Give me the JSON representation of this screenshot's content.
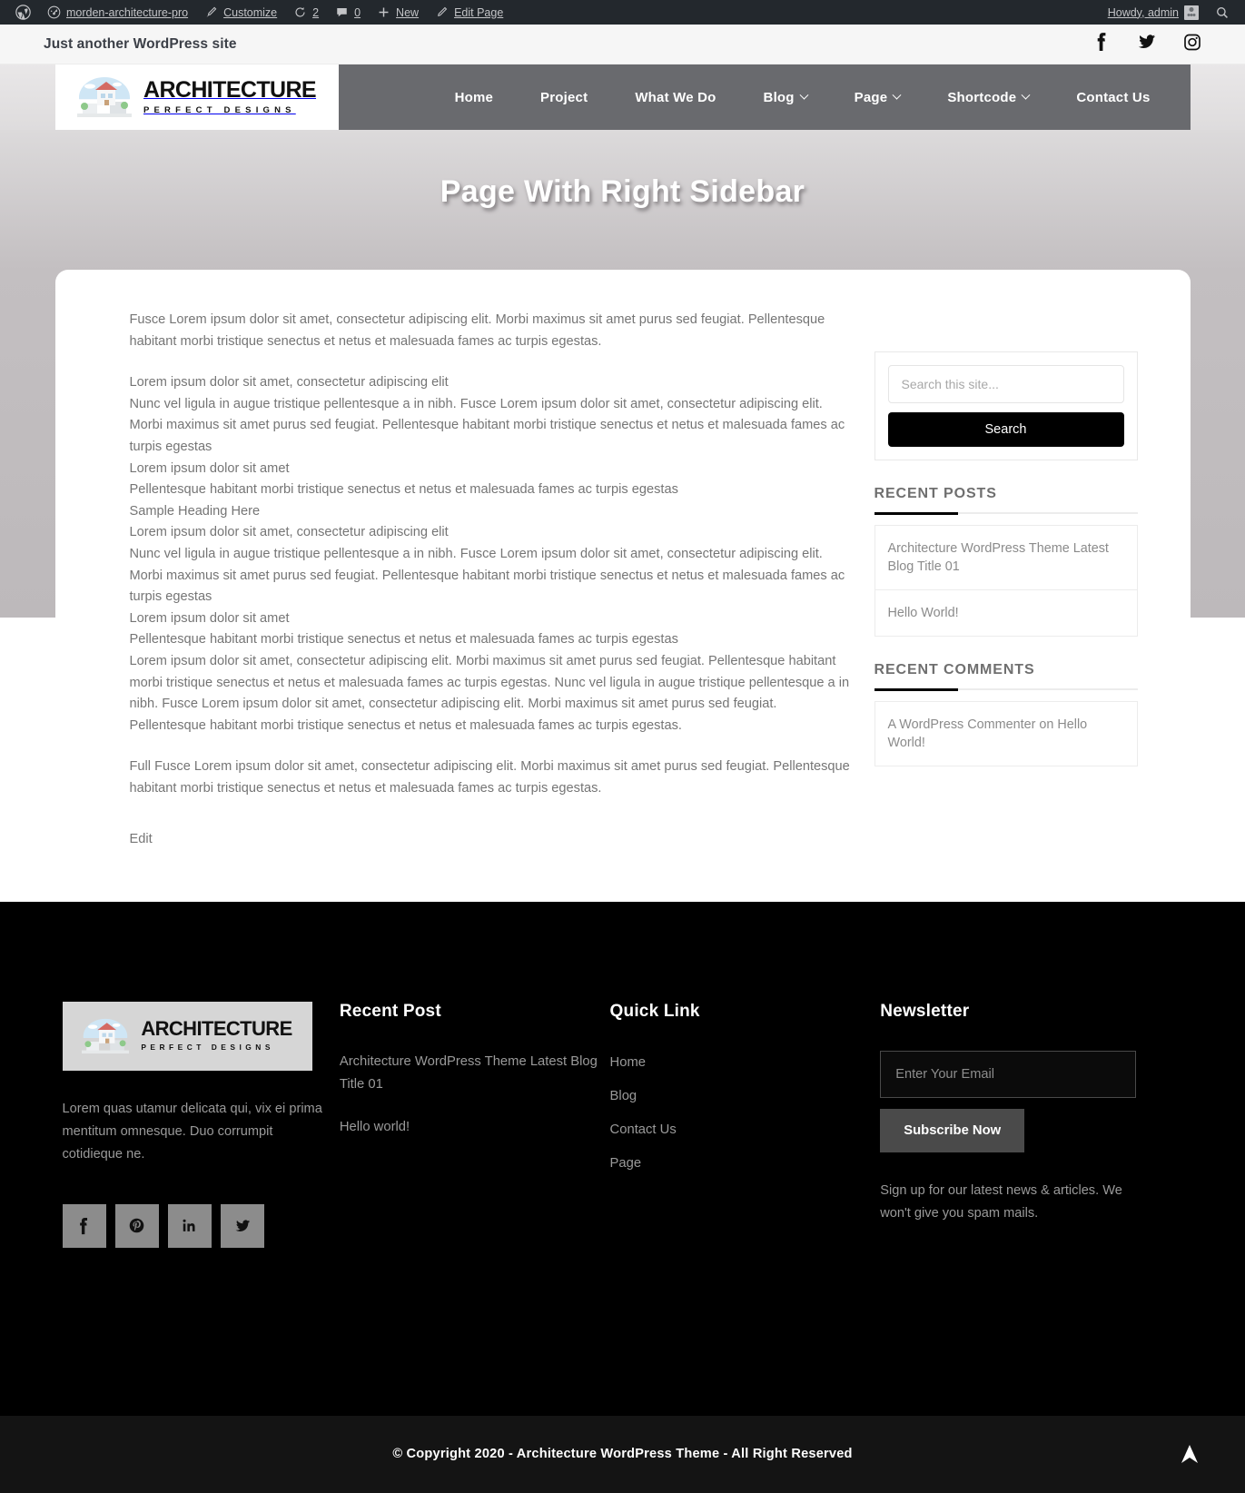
{
  "adminbar": {
    "site_name": "morden-architecture-pro",
    "customize": "Customize",
    "updates_count": "2",
    "comments_count": "0",
    "new": "New",
    "edit_page": "Edit Page",
    "howdy": "Howdy, admin"
  },
  "topbar": {
    "tagline": "Just another WordPress site",
    "social": [
      {
        "name": "facebook",
        "label": "Facebook"
      },
      {
        "name": "twitter",
        "label": "Twitter"
      },
      {
        "name": "instagram",
        "label": "Instagram"
      }
    ]
  },
  "logo": {
    "line1": "ARCHITECTURE",
    "line2": "PERFECT DESIGNS"
  },
  "nav": {
    "items": [
      {
        "label": "Home",
        "has_dropdown": false
      },
      {
        "label": "Project",
        "has_dropdown": false
      },
      {
        "label": "What We Do",
        "has_dropdown": false
      },
      {
        "label": "Blog",
        "has_dropdown": true
      },
      {
        "label": "Page",
        "has_dropdown": true
      },
      {
        "label": "Shortcode",
        "has_dropdown": true
      },
      {
        "label": "Contact Us",
        "has_dropdown": false
      }
    ]
  },
  "banner": {
    "title": "Page With Right Sidebar"
  },
  "content": {
    "para1": "Fusce Lorem ipsum dolor sit amet, consectetur adipiscing elit. Morbi maximus sit amet purus sed feugiat. Pellentesque habitant morbi tristique senectus et netus et malesuada fames ac turpis egestas.",
    "lines": [
      "Lorem ipsum dolor sit amet, consectetur adipiscing elit",
      "Nunc vel ligula in augue tristique pellentesque a in nibh. Fusce Lorem ipsum dolor sit amet, consectetur adipiscing elit. Morbi maximus sit amet purus sed feugiat. Pellentesque habitant morbi tristique senectus et netus et malesuada fames ac turpis egestas",
      "Lorem ipsum dolor sit amet",
      "Pellentesque habitant morbi tristique senectus et netus et malesuada fames ac turpis egestas",
      "Sample Heading Here",
      "Lorem ipsum dolor sit amet, consectetur adipiscing elit",
      "Nunc vel ligula in augue tristique pellentesque a in nibh. Fusce Lorem ipsum dolor sit amet, consectetur adipiscing elit. Morbi maximus sit amet purus sed feugiat. Pellentesque habitant morbi tristique senectus et netus et malesuada fames ac turpis egestas",
      "Lorem ipsum dolor sit amet",
      "Pellentesque habitant morbi tristique senectus et netus et malesuada fames ac turpis egestas",
      "Lorem ipsum dolor sit amet, consectetur adipiscing elit. Morbi maximus sit amet purus sed feugiat. Pellentesque habitant morbi tristique senectus et netus et malesuada fames ac turpis egestas. Nunc vel ligula in augue tristique pellentesque a in nibh. Fusce Lorem ipsum dolor sit amet, consectetur adipiscing elit. Morbi maximus sit amet purus sed feugiat. Pellentesque habitant morbi tristique senectus et netus et malesuada fames ac turpis egestas."
    ],
    "para2": "Full Fusce Lorem ipsum dolor sit amet, consectetur adipiscing elit. Morbi maximus sit amet purus sed feugiat. Pellentesque habitant morbi tristique senectus et netus et malesuada fames ac turpis egestas.",
    "edit_label": "Edit"
  },
  "sidebar": {
    "search": {
      "placeholder": "Search this site...",
      "value": "",
      "button": "Search"
    },
    "recent_posts": {
      "title": "RECENT POSTS",
      "items": [
        "Architecture WordPress Theme Latest Blog Title 01",
        "Hello World!"
      ]
    },
    "recent_comments": {
      "title": "RECENT COMMENTS",
      "items": [
        "A WordPress Commenter on Hello World!"
      ]
    }
  },
  "footer": {
    "about": {
      "text": "Lorem quas utamur delicata qui, vix ei prima mentitum omnesque. Duo corrumpit cotidieque ne.",
      "social": [
        {
          "name": "facebook",
          "label": "Facebook"
        },
        {
          "name": "pinterest",
          "label": "Pinterest"
        },
        {
          "name": "linkedin",
          "label": "LinkedIn"
        },
        {
          "name": "twitter",
          "label": "Twitter"
        }
      ]
    },
    "recent_post": {
      "title": "Recent Post",
      "items": [
        "Architecture WordPress Theme Latest Blog Title 01",
        "Hello world!"
      ]
    },
    "quick_link": {
      "title": "Quick Link",
      "items": [
        "Home",
        "Blog",
        "Contact Us",
        "Page"
      ]
    },
    "newsletter": {
      "title": "Newsletter",
      "placeholder": "Enter Your Email",
      "value": "",
      "button": "Subscribe Now",
      "note": "Sign up for our latest news & articles. We won't give you spam mails."
    },
    "copyright": "© Copyright 2020 - Architecture WordPress Theme - All Right Reserved"
  },
  "colors": {
    "nav_bg": "#696a6e",
    "admin_bg": "#23282d",
    "footer_bg": "#000000",
    "accent": "#000000"
  }
}
